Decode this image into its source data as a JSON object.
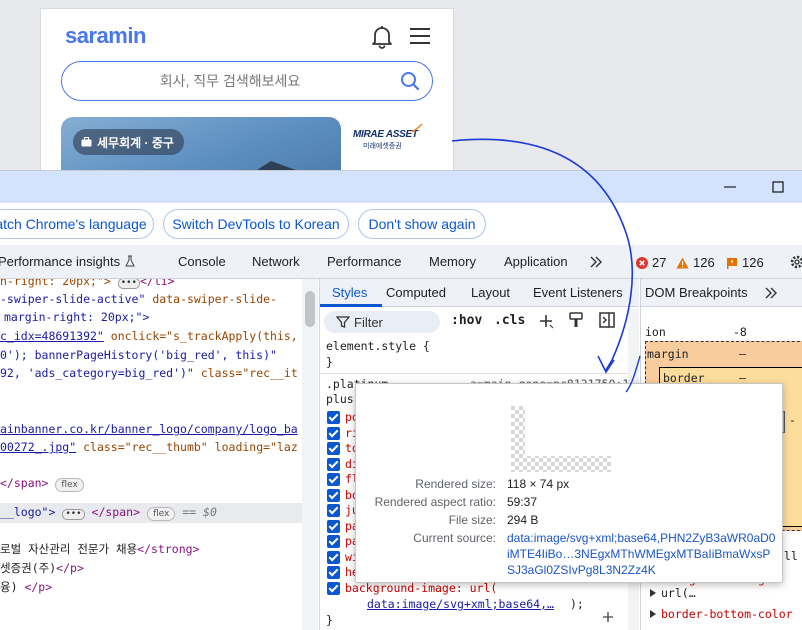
{
  "site": {
    "logo": "saramin",
    "search_placeholder": "회사, 직무 검색해보세요",
    "banner_tag": "세무회계 · 중구",
    "banner_brand": "MIRAE ASSET",
    "banner_brand_sub": "미래에셋증권"
  },
  "devtools": {
    "lang_buttons": [
      "atch Chrome's language",
      "Switch DevTools to Korean",
      "Don't show again"
    ],
    "tabs": [
      "Performance insights",
      "Console",
      "Network",
      "Performance",
      "Memory",
      "Application"
    ],
    "counts": {
      "errors": "27",
      "warnings": "126",
      "issues": "126"
    },
    "elements": {
      "lines": [
        "n-right: 20px;\">",
        "</li>",
        "-swiper-slide-active\"",
        "data-swiper-slide-",
        "margin-right: 20px;\">",
        "c_idx=48691392\"",
        "onclick=\"s_trackApply(this,",
        "0'); bannerPageHistory('big_red', this)\"",
        "92, 'ads_category=big_red')\"",
        "class=\"rec__it",
        "ainbanner.co.kr/banner_logo/company/logo_ba",
        "00272_.jpg\"",
        "class=\"rec__thumb\"",
        "loading=\"laz",
        "</span>",
        "flex",
        "__logo\">",
        "</span>",
        "flex",
        "== $0",
        "로벌 자산관리 전문가 채용",
        "</strong>",
        "셋증권(주)",
        "</p>",
        "융)",
        "</p>"
      ]
    },
    "styles": {
      "subtabs": [
        "Styles",
        "Computed",
        "Layout",
        "Event Listeners",
        "DOM Breakpoints"
      ],
      "filter_placeholder": "Filter",
      "hov": ":hov",
      "cls": ".cls",
      "element_style": "element.style {",
      "close_brace": "}",
      "rule_selector": ".platinum",
      "rule_selector2": "plus",
      "rule_source": "a=main_gene=pc8131750:107",
      "props": [
        "po",
        "ri",
        "to",
        "di",
        "fl",
        "bo",
        "ju",
        "pa",
        "pa",
        "wi",
        "he"
      ],
      "bg_prop": "background-image: url(",
      "bg_value": "data:image/svg+xml;base64,…",
      "bg_end": ");",
      "close": "}"
    },
    "right": {
      "position": "ion",
      "position_val": "-8",
      "margin": "margin",
      "margin_val": "–",
      "border": "border",
      "border_val": "–",
      "content_dash": "-",
      "all": "all",
      "bg_image": "background-image",
      "url": "url(…",
      "border_bottom": "border-bottom-color"
    },
    "tooltip": {
      "rendered_size_label": "Rendered size:",
      "rendered_size": "118 × 74 px",
      "aspect_label": "Rendered aspect ratio:",
      "aspect": "59:37",
      "file_size_label": "File size:",
      "file_size": "294 B",
      "source_label": "Current source:",
      "source": "data:image/svg+xml;base64,PHN2ZyB3aWR0aD0iMTE4IiBo…3NEgxMThWMEgxMTBaIiBmaWxsPSJ3aGl0ZSIvPg8L3N2Zz4K"
    }
  },
  "colors": {
    "brand": "#4876ef",
    "devtools_blue": "#0b57d0",
    "titlebar": "#d3e3fd"
  }
}
